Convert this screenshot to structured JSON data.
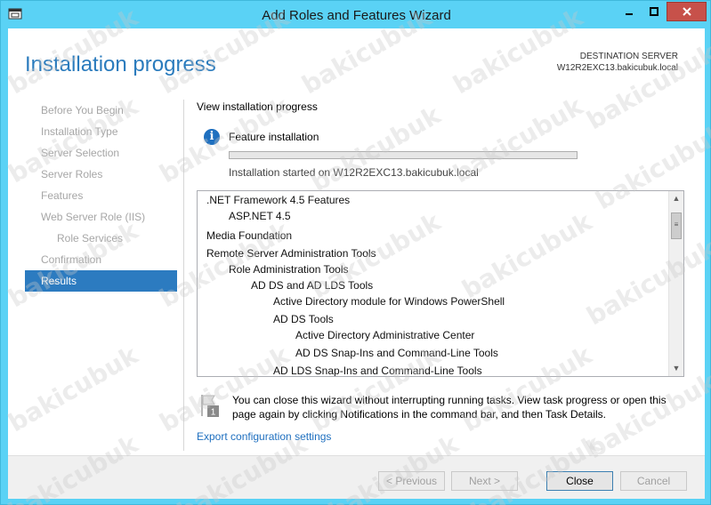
{
  "window": {
    "title": "Add Roles and Features Wizard",
    "controls": {
      "minimize": "▬",
      "maximize": "☐",
      "close": "✕"
    }
  },
  "header": {
    "page_title": "Installation progress",
    "destination_label": "DESTINATION SERVER",
    "destination_server": "W12R2EXC13.bakicubuk.local"
  },
  "nav": {
    "items": [
      {
        "label": "Before You Begin",
        "level": 0,
        "active": false
      },
      {
        "label": "Installation Type",
        "level": 0,
        "active": false
      },
      {
        "label": "Server Selection",
        "level": 0,
        "active": false
      },
      {
        "label": "Server Roles",
        "level": 0,
        "active": false
      },
      {
        "label": "Features",
        "level": 0,
        "active": false
      },
      {
        "label": "Web Server Role (IIS)",
        "level": 0,
        "active": false
      },
      {
        "label": "Role Services",
        "level": 1,
        "active": false
      },
      {
        "label": "Confirmation",
        "level": 0,
        "active": false
      },
      {
        "label": "Results",
        "level": 0,
        "active": true
      }
    ]
  },
  "content": {
    "view_label": "View installation progress",
    "feature_label": "Feature installation",
    "progress": 0.0,
    "started_text": "Installation started on W12R2EXC13.bakicubuk.local",
    "features": [
      {
        "label": ".NET Framework 4.5 Features",
        "level": 0
      },
      {
        "label": "ASP.NET 4.5",
        "level": 1
      },
      {
        "label": "Media Foundation",
        "level": 0
      },
      {
        "label": "Remote Server Administration Tools",
        "level": 0
      },
      {
        "label": "Role Administration Tools",
        "level": 1
      },
      {
        "label": "AD DS and AD LDS Tools",
        "level": 2
      },
      {
        "label": "Active Directory module for Windows PowerShell",
        "level": 3
      },
      {
        "label": "AD DS Tools",
        "level": 3
      },
      {
        "label": "Active Directory Administrative Center",
        "level": 4
      },
      {
        "label": "AD DS Snap-Ins and Command-Line Tools",
        "level": 4
      },
      {
        "label": "AD LDS Snap-Ins and Command-Line Tools",
        "level": 3
      }
    ],
    "notification_text": "You can close this wizard without interrupting running tasks. View task progress or open this page again by clicking Notifications in the command bar, and then Task Details.",
    "notification_badge": "1",
    "export_link": "Export configuration settings"
  },
  "buttons": {
    "previous": "< Previous",
    "next": "Next >",
    "close": "Close",
    "cancel": "Cancel"
  },
  "watermark": "bakicubuk",
  "colors": {
    "accent": "#2c7bc0",
    "title_blue": "#2a7bbd",
    "frame": "#5ad2f5"
  }
}
